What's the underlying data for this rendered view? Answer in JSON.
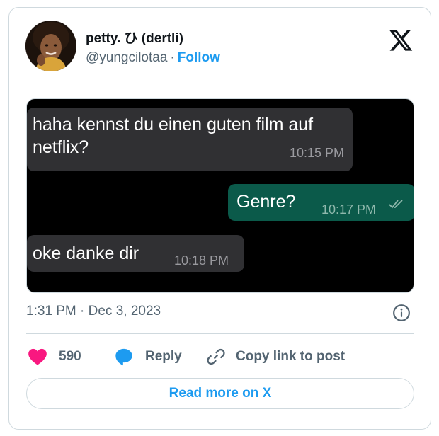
{
  "author": {
    "display_name": "petty. ひ (dertli)",
    "handle": "@yungcilotaa",
    "separator": "·",
    "follow_label": "Follow",
    "avatar_icon": "profile-photo"
  },
  "brand": {
    "logo_icon": "x-logo-icon"
  },
  "chat": {
    "messages": [
      {
        "direction": "incoming",
        "text": "haha kennst du einen guten film auf netflix?",
        "time": "10:15 PM"
      },
      {
        "direction": "outgoing",
        "text": "Genre?",
        "time": "10:17 PM",
        "status_icon": "double-check-icon"
      },
      {
        "direction": "incoming",
        "text": "oke danke dir",
        "time": "10:18 PM"
      }
    ]
  },
  "tweet": {
    "timestamp": "1:31 PM · Dec 3, 2023",
    "info_icon": "info-icon"
  },
  "actions": {
    "like": {
      "icon": "heart-icon",
      "count": "590",
      "color": "#f91880"
    },
    "reply": {
      "icon": "speech-bubble-icon",
      "label": "Reply",
      "color": "#1d9bf0"
    },
    "copy": {
      "icon": "link-icon",
      "label": "Copy link to post"
    }
  },
  "footer": {
    "read_more_label": "Read more on X"
  },
  "colors": {
    "accent": "#1d9bf0",
    "muted": "#536471",
    "border": "#cfd9de"
  }
}
